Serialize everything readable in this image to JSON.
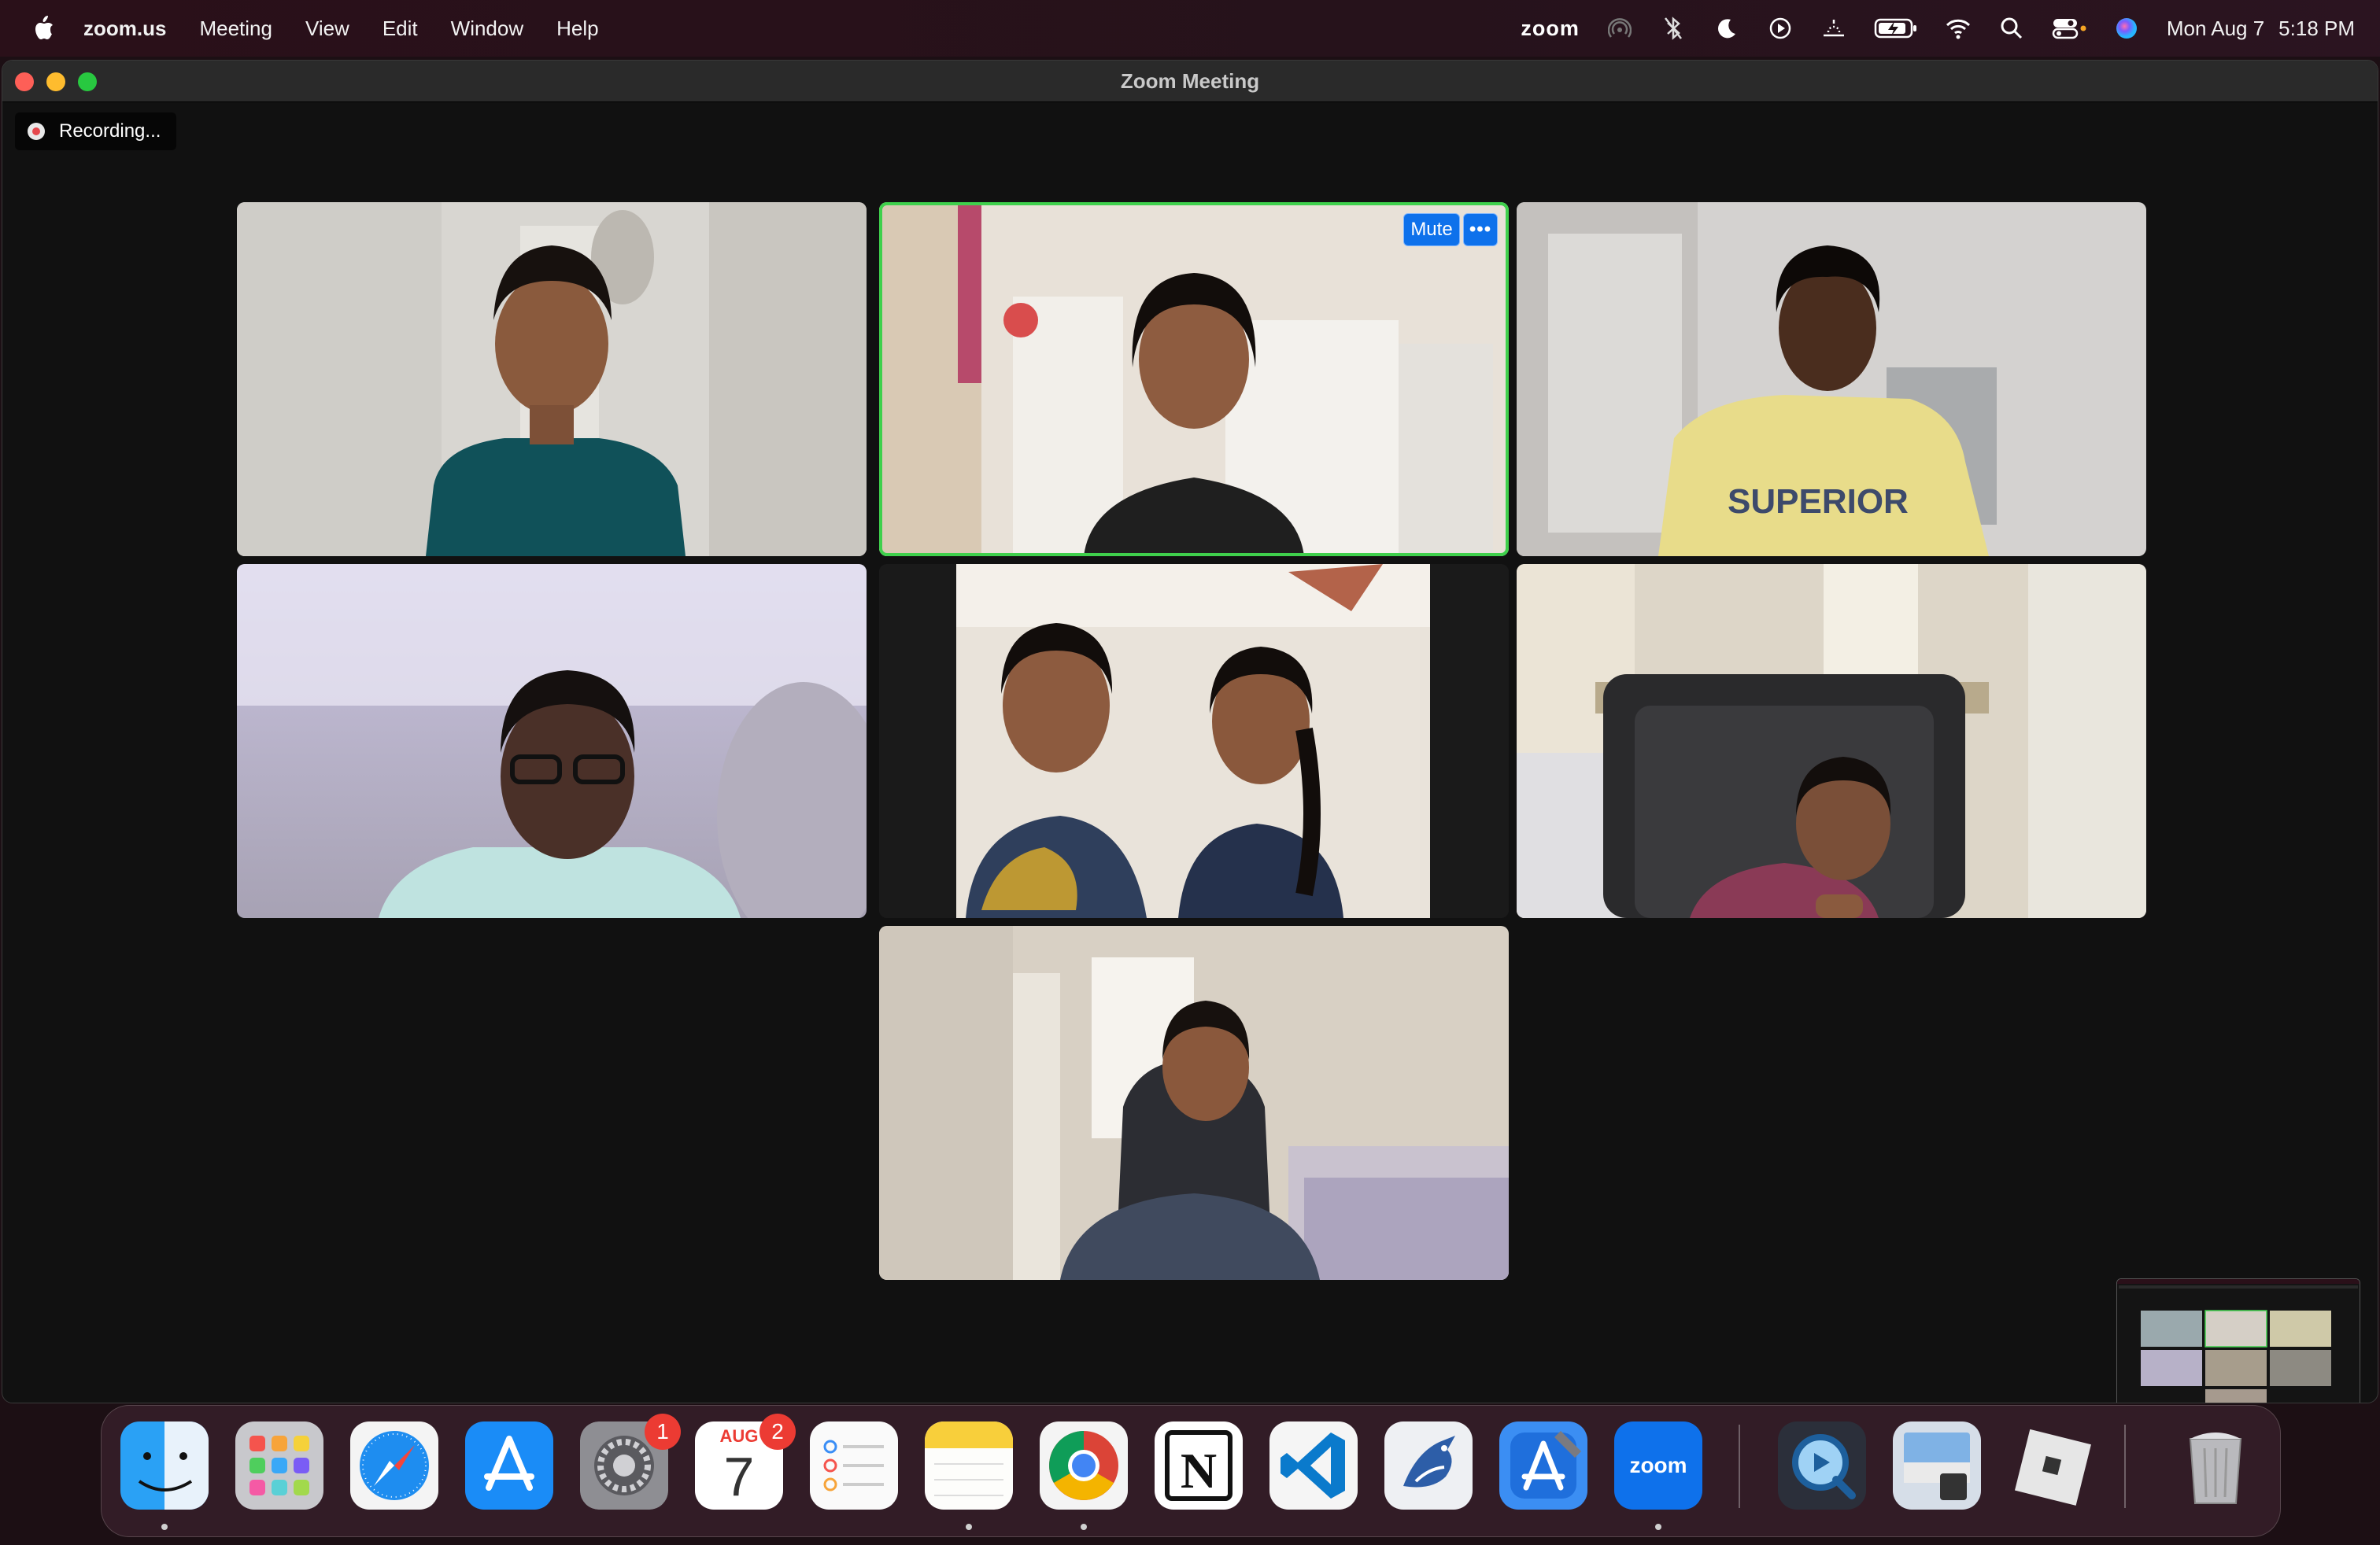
{
  "menubar": {
    "app_name": "zoom.us",
    "menus": [
      "Meeting",
      "View",
      "Edit",
      "Window",
      "Help"
    ],
    "zoom_status": "zoom",
    "status_icons": [
      "airdrop-icon",
      "bluetooth-icon",
      "focus-moon-icon",
      "screen-record-icon",
      "weather-icon",
      "battery-charging-icon",
      "wifi-icon",
      "spotlight-search-icon",
      "control-center-icon",
      "siri-icon"
    ],
    "date": "Mon Aug 7",
    "time": "5:18 PM"
  },
  "window": {
    "title": "Zoom Meeting",
    "recording_label": "Recording..."
  },
  "gallery": {
    "tile_count": 7,
    "active_speaker_index": 1,
    "active_tile_controls": {
      "mute_label": "Mute",
      "more_label": "•••"
    },
    "active_border_color": "#3fd04c"
  },
  "dock": {
    "apps": [
      {
        "name": "Finder",
        "running": true
      },
      {
        "name": "Launchpad",
        "running": false
      },
      {
        "name": "Safari",
        "running": false
      },
      {
        "name": "App Store",
        "running": false
      },
      {
        "name": "System Settings",
        "running": false,
        "badge": "1"
      },
      {
        "name": "Calendar",
        "running": false,
        "badge": "2",
        "month": "AUG",
        "day": "7"
      },
      {
        "name": "Reminders",
        "running": false
      },
      {
        "name": "Notes",
        "running": true
      },
      {
        "name": "Google Chrome",
        "running": true
      },
      {
        "name": "Notion",
        "running": false
      },
      {
        "name": "Visual Studio Code",
        "running": false
      },
      {
        "name": "BlueJ",
        "running": false
      },
      {
        "name": "Xcode",
        "running": false
      },
      {
        "name": "zoom.us",
        "running": true,
        "label": "zoom"
      },
      {
        "name": "QuickTime Player",
        "running": false
      },
      {
        "name": "Preview",
        "running": false
      },
      {
        "name": "Roblox",
        "running": false
      },
      {
        "name": "Trash",
        "running": false
      }
    ]
  },
  "colors": {
    "zoom_blue": "#0e71eb",
    "badge_red": "#ec3b33",
    "recording_red": "#e5484d"
  }
}
